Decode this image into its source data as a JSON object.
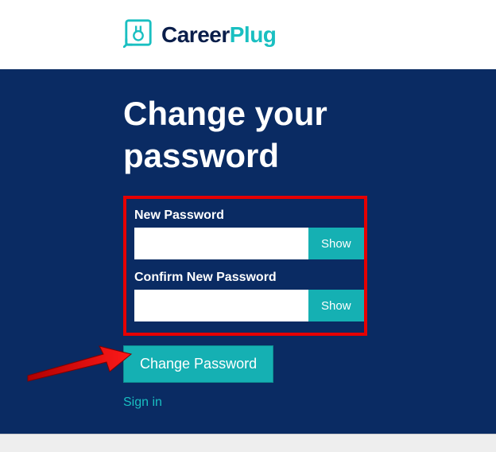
{
  "brand": {
    "name_part1": "Career",
    "name_part2": "Plug",
    "accent_color": "#19bfc1",
    "dark_color": "#0a2b63"
  },
  "page": {
    "title": "Change your password"
  },
  "form": {
    "new_password": {
      "label": "New Password",
      "value": "",
      "show_button": "Show"
    },
    "confirm_password": {
      "label": "Confirm New Password",
      "value": "",
      "show_button": "Show"
    },
    "submit_label": "Change Password"
  },
  "links": {
    "signin": "Sign in"
  },
  "annotations": {
    "highlight_color": "#e60000",
    "arrow_color": "#e60000"
  }
}
